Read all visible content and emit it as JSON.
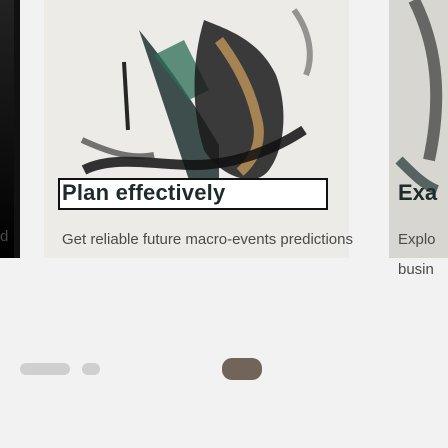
{
  "cards": [
    {
      "title": "Plan effectively",
      "description": "Get reliable future macro-events predictions"
    },
    {
      "title": "Exa",
      "description_lines": [
        "Explo",
        "busin"
      ]
    }
  ],
  "left_fragment": "d"
}
